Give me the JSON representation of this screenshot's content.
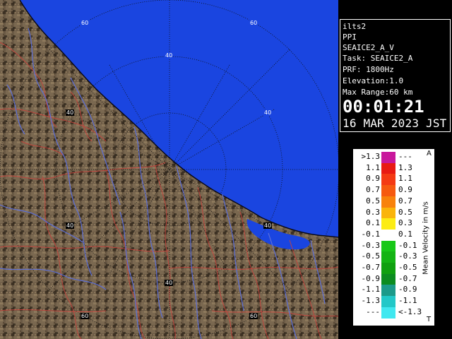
{
  "map": {
    "land_color": "#6b5a45",
    "sea_color": "#1a45e0",
    "river_color": "#5c6fd8",
    "boundary_color": "#c8423c",
    "ring_labels": [
      "60",
      "60",
      "40",
      "40",
      "40",
      "40",
      "40",
      "40",
      "60",
      "60"
    ]
  },
  "info": {
    "site": "ilts2",
    "product": "PPI",
    "field": "SEAICE2_A_V",
    "task": "Task: SEAICE2_A",
    "prf": "PRF: 1800Hz",
    "elevation": "Elevation:1.0",
    "max_range": "Max Range:60 km",
    "time": "00:01:21",
    "date": "16 MAR 2023 JST"
  },
  "legend": {
    "title": "Mean Velocity in m/s",
    "top_mark": "A",
    "bottom_mark": "T",
    "rows": [
      {
        "left": ">1.3",
        "right": "---",
        "color": "#c8189c"
      },
      {
        "left": "1.1",
        "right": "1.3",
        "color": "#e81a14"
      },
      {
        "left": "0.9",
        "right": "1.1",
        "color": "#f43a14"
      },
      {
        "left": "0.7",
        "right": "0.9",
        "color": "#f65a10"
      },
      {
        "left": "0.5",
        "right": "0.7",
        "color": "#f8820c"
      },
      {
        "left": "0.3",
        "right": "0.5",
        "color": "#fab40a"
      },
      {
        "left": "0.1",
        "right": "0.3",
        "color": "#fcec14"
      },
      {
        "left": "-0.1",
        "right": "0.1",
        "color": "#ffffff"
      },
      {
        "left": "-0.3",
        "right": "-0.1",
        "color": "#18c818"
      },
      {
        "left": "-0.5",
        "right": "-0.3",
        "color": "#14b414"
      },
      {
        "left": "-0.7",
        "right": "-0.5",
        "color": "#10a010"
      },
      {
        "left": "-0.9",
        "right": "-0.7",
        "color": "#0c8c20"
      },
      {
        "left": "-1.1",
        "right": "-0.9",
        "color": "#1c9a8a"
      },
      {
        "left": "-1.3",
        "right": "-1.1",
        "color": "#22c8c8"
      },
      {
        "left": "---",
        "right": "<-1.3",
        "color": "#40e8f0"
      }
    ]
  }
}
